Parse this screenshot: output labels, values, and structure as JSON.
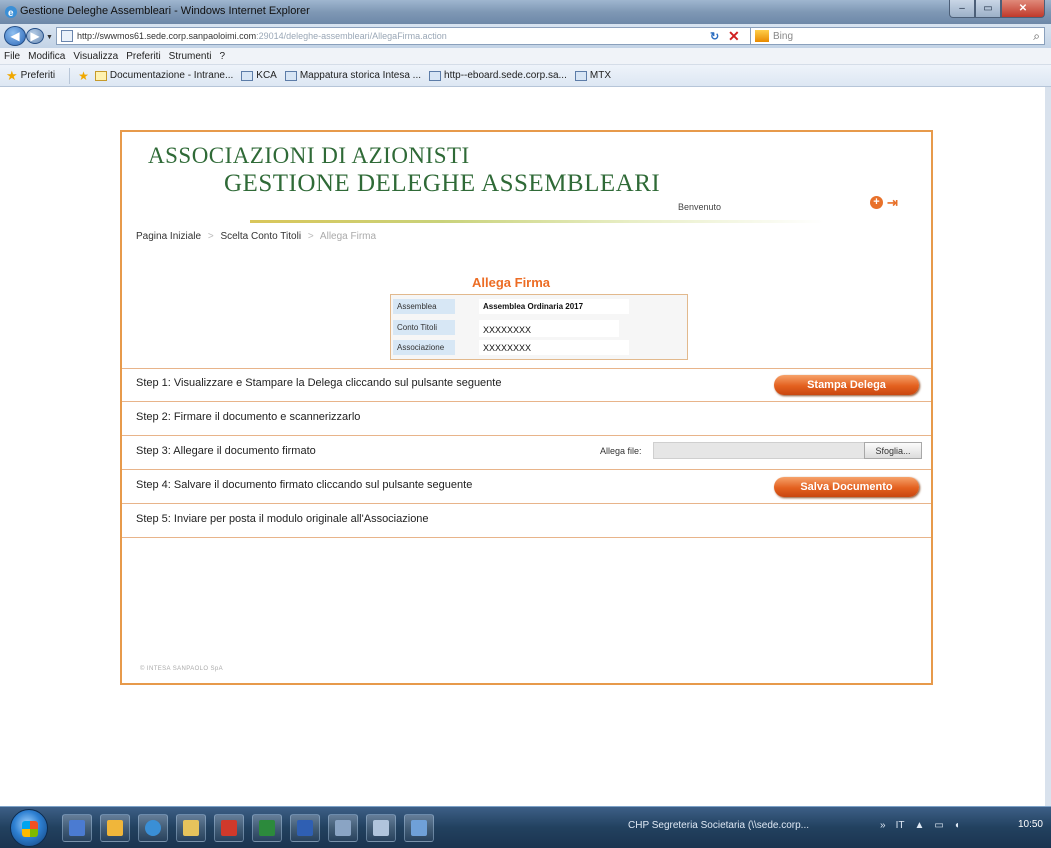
{
  "window": {
    "title": "Gestione Deleghe Assembleari - Windows Internet Explorer",
    "buttons": {
      "minimize": "–",
      "restore": "▭",
      "close": "✕"
    }
  },
  "address_bar": {
    "url_main": "http://swwmos61.sede.corp.sanpaoloimi.com",
    "url_rest": ":29014/deleghe-assembleari/AllegaFirma.action",
    "search_placeholder": "Bing"
  },
  "menu": [
    "File",
    "Modifica",
    "Visualizza",
    "Preferiti",
    "Strumenti",
    "?"
  ],
  "favorites_bar": {
    "label": "Preferiti",
    "items": [
      {
        "label": "Documentazione - Intrane...",
        "icon": "document-icon"
      },
      {
        "label": "KCA",
        "icon": "page-icon"
      },
      {
        "label": "Mappatura storica Intesa ...",
        "icon": "page-icon"
      },
      {
        "label": "http--eboard.sede.corp.sa...",
        "icon": "page-icon"
      },
      {
        "label": "MTX",
        "icon": "page-icon"
      }
    ]
  },
  "page": {
    "brand_line1": "ASSOCIAZIONI DI AZIONISTI",
    "brand_line2": "GESTIONE DELEGHE ASSEMBLEARI",
    "welcome": "Benvenuto",
    "breadcrumb": {
      "home": "Pagina Iniziale",
      "sep1": ">",
      "conto": "Scelta Conto Titoli",
      "sep2": ">",
      "current": "Allega Firma"
    },
    "section_title": "Allega Firma",
    "info": [
      {
        "label": "Assemblea",
        "value": "Assemblea Ordinaria 2017"
      },
      {
        "label": "Conto Titoli",
        "value": "XXXXXXXX"
      },
      {
        "label": "Associazione",
        "value": "XXXXXXXX"
      }
    ],
    "steps": [
      {
        "text": "Step 1: Visualizzare e Stampare la Delega cliccando sul pulsante seguente",
        "button": "Stampa Delega"
      },
      {
        "text": "Step 2: Firmare il documento e scannerizzarlo"
      },
      {
        "text": "Step 3: Allegare il documento firmato",
        "file_label": "Allega file:",
        "browse": "Sfoglia..."
      },
      {
        "text": "Step 4: Salvare il documento firmato cliccando sul pulsante seguente",
        "button": "Salva Documento"
      },
      {
        "text": "Step 5: Inviare per posta il modulo originale all'Associazione"
      }
    ],
    "footer": "© INTESA SANPAOLO SpA"
  },
  "taskbar": {
    "active_task": "CHP Segreteria Societaria (\\\\sede.corp...",
    "tray": [
      "»",
      "IT",
      "▲",
      "▭",
      "◖"
    ],
    "clock": "10:50"
  },
  "colors": {
    "brand_green": "#2f6a37",
    "accent_orange": "#ec6c24",
    "border_orange": "#e79a4b"
  }
}
